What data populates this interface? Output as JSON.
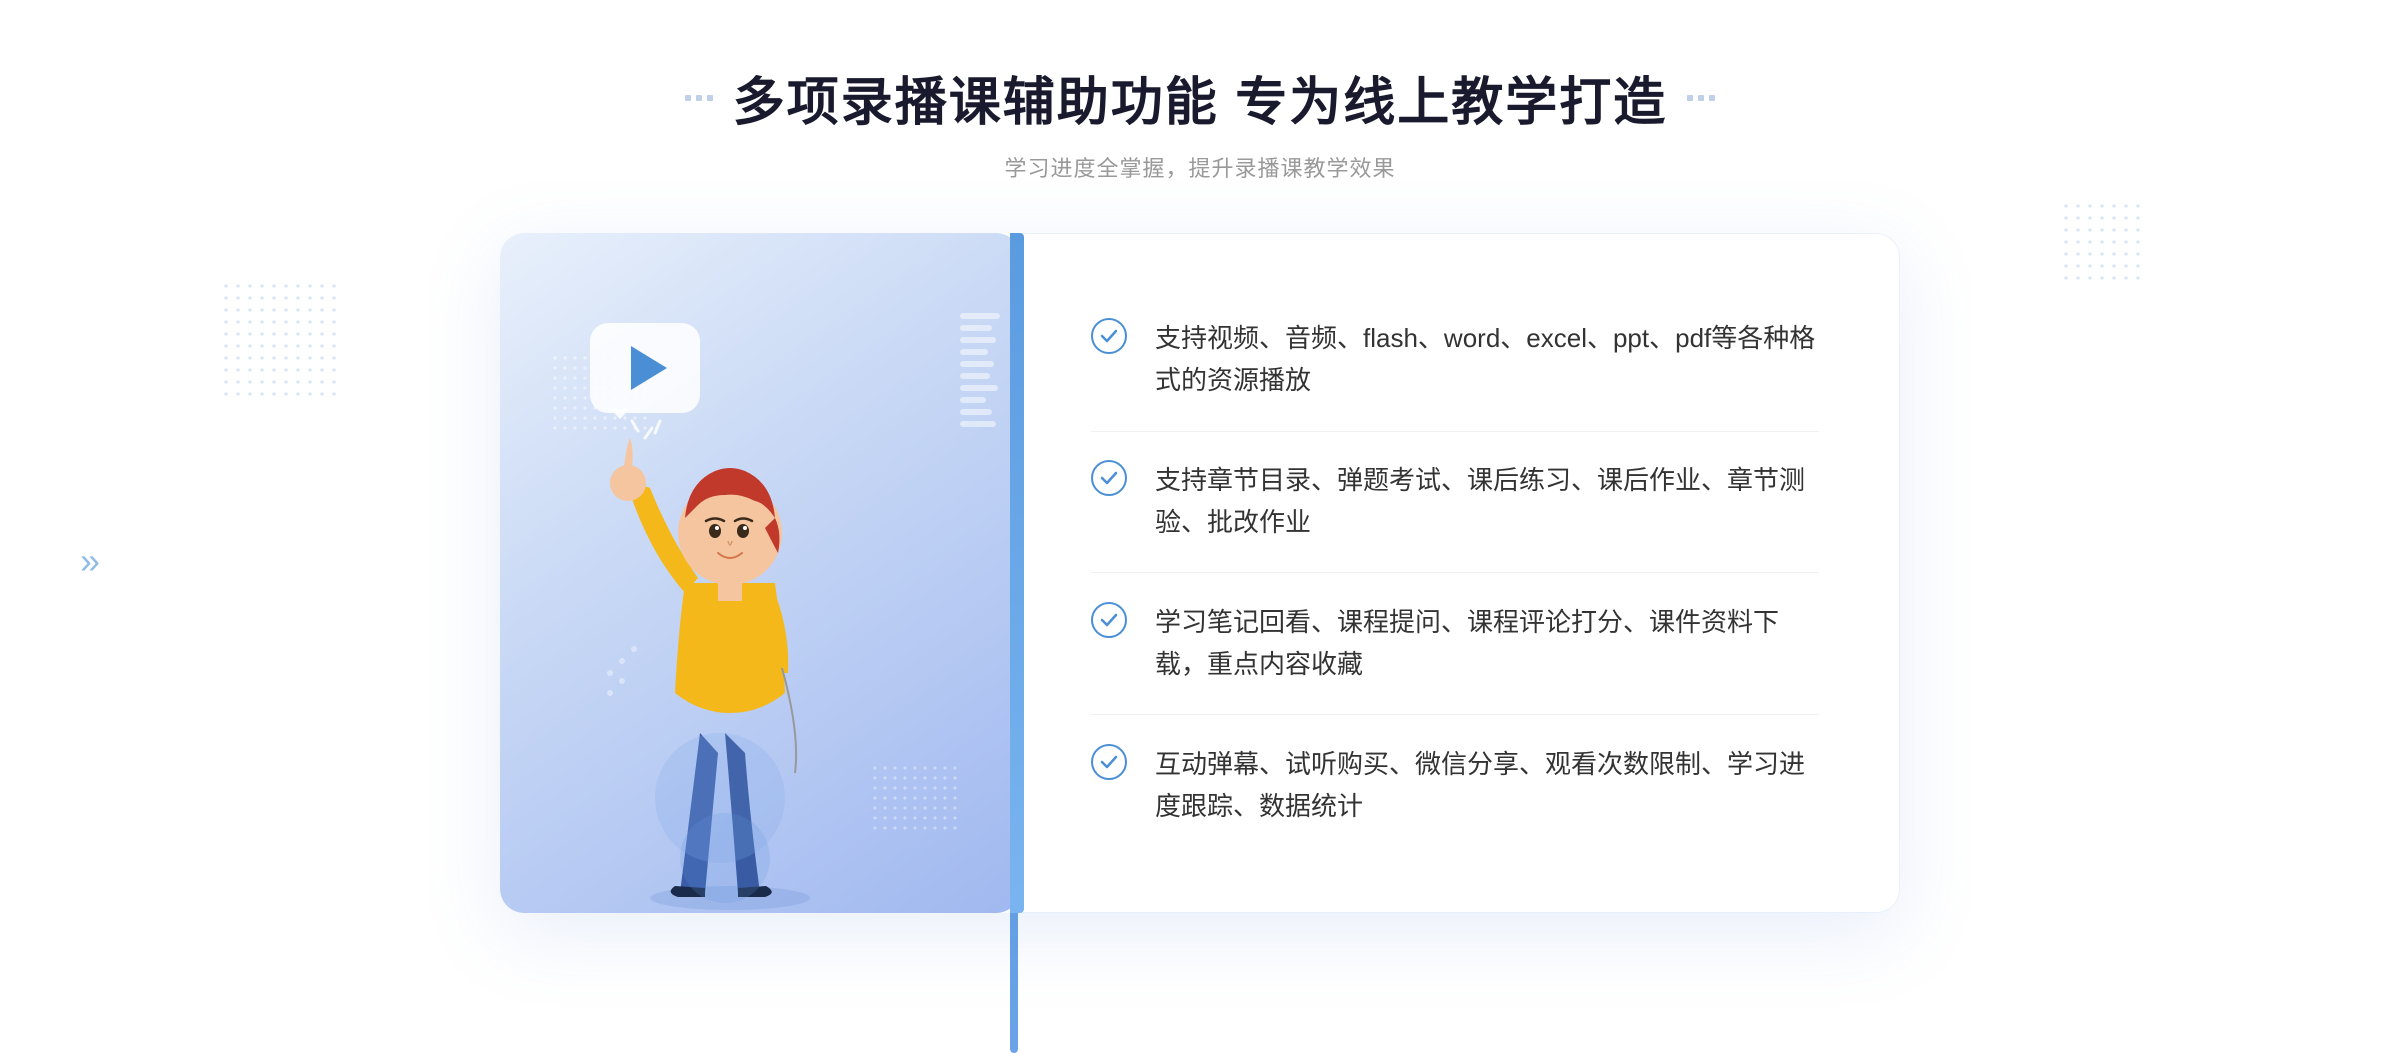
{
  "header": {
    "decorator_label": "decorators",
    "title": "多项录播课辅助功能 专为线上教学打造",
    "subtitle": "学习进度全掌握，提升录播课教学效果"
  },
  "features": [
    {
      "id": 1,
      "text": "支持视频、音频、flash、word、excel、ppt、pdf等各种格式的资源播放"
    },
    {
      "id": 2,
      "text": "支持章节目录、弹题考试、课后练习、课后作业、章节测验、批改作业"
    },
    {
      "id": 3,
      "text": "学习笔记回看、课程提问、课程评论打分、课件资料下载，重点内容收藏"
    },
    {
      "id": 4,
      "text": "互动弹幕、试听购买、微信分享、观看次数限制、学习进度跟踪、数据统计"
    }
  ],
  "chevron_symbol": "»",
  "play_alt": "play button"
}
